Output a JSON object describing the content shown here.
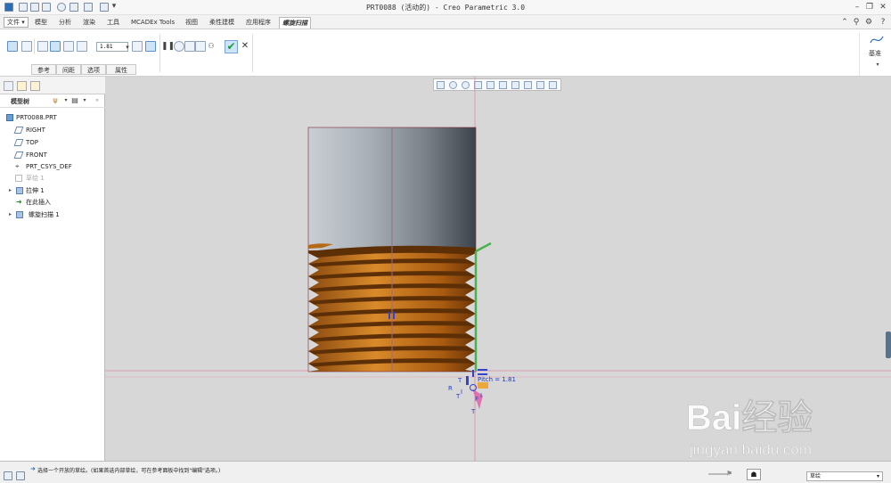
{
  "window": {
    "title": "PRT0088 (活动的) - Creo Parametric 3.0"
  },
  "menu": {
    "tabs": [
      "文件",
      "模型",
      "分析",
      "渲染",
      "工具",
      "MCADEx Tools",
      "视图",
      "柔性建模",
      "应用程序",
      "螺旋扫描"
    ],
    "active": "螺旋扫描"
  },
  "ribbon": {
    "pitch_value": "1.81",
    "subtabs": [
      "参考",
      "间距",
      "选项",
      "属性"
    ],
    "datum_label": "基准"
  },
  "model_tree": {
    "title": "模型树",
    "items": [
      {
        "label": "PRT0088.PRT"
      },
      {
        "label": "RIGHT"
      },
      {
        "label": "TOP"
      },
      {
        "label": "FRONT"
      },
      {
        "label": "PRT_CSYS_DEF"
      },
      {
        "label": "草绘 1"
      },
      {
        "label": "拉伸 1"
      },
      {
        "label": "在此插入"
      },
      {
        "label": "螺旋扫描 1"
      }
    ]
  },
  "viewport": {
    "pitch_annotation": "Pitch = 1.81",
    "marker_labels": [
      "T",
      "R",
      "T",
      "T",
      "I",
      "I",
      "F"
    ]
  },
  "statusbar": {
    "message": "选择一个开放的草绘。(如果首选内部草绘，可在参考面板中找到\"编辑\"选项。)",
    "filter": "草绘"
  },
  "watermark": {
    "brand_text": "Bai经验",
    "url": "jingyan.baidu.com"
  },
  "colors": {
    "thread": "#a85a10",
    "thread_light": "#d98a2a",
    "cylinder": "#8d949c",
    "accent": "#2b6fb3"
  }
}
